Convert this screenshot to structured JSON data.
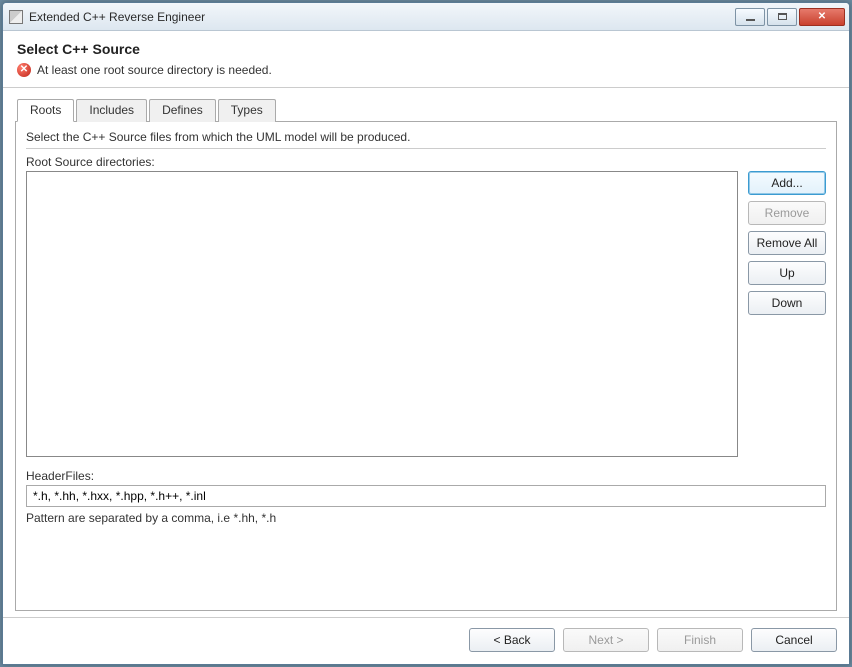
{
  "window": {
    "title": "Extended C++ Reverse Engineer"
  },
  "header": {
    "page_title": "Select C++ Source",
    "error_text": "At least one root source directory is needed."
  },
  "tabs": {
    "roots": "Roots",
    "includes": "Includes",
    "defines": "Defines",
    "types": "Types"
  },
  "roots_panel": {
    "instruction": "Select the C++ Source files from which the UML model will be produced.",
    "list_label": "Root Source directories:",
    "buttons": {
      "add": "Add...",
      "remove": "Remove",
      "remove_all": "Remove All",
      "up": "Up",
      "down": "Down"
    },
    "header_files_label": "HeaderFiles:",
    "header_files_value": "*.h, *.hh, *.hxx, *.hpp, *.h++, *.inl",
    "hint": "Pattern are separated by a comma, i.e *.hh, *.h"
  },
  "footer": {
    "back": "< Back",
    "next": "Next >",
    "finish": "Finish",
    "cancel": "Cancel"
  }
}
